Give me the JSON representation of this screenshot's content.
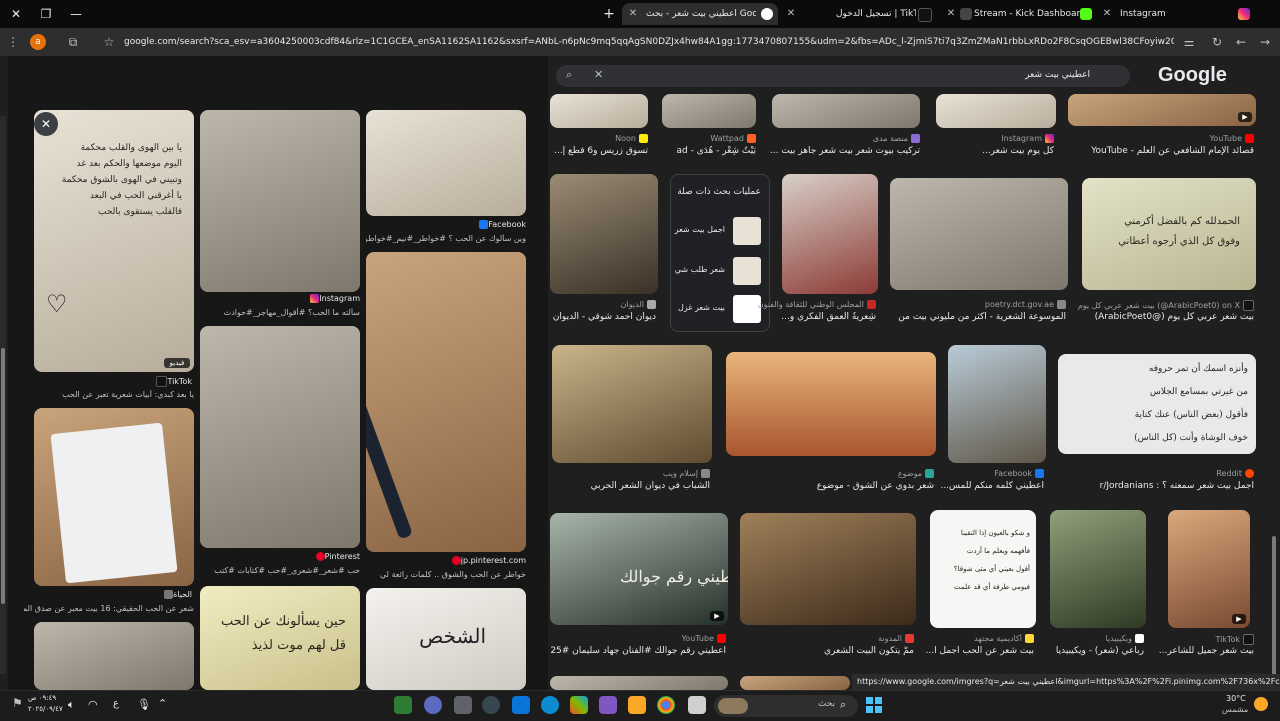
{
  "browser": {
    "tabs": [
      {
        "title": "اعطيني بيت شعر - بحث Google",
        "active": true
      },
      {
        "title": "تسجيل الدخول | TikTok"
      },
      {
        "title": "Stream - Kick Dashboard"
      },
      {
        "title": "Instagram"
      }
    ],
    "url": "google.com/search?sca_esv=a3604250003cdf84&rlz=1C1GCEA_enSA1162SA1162&sxsrf=ANbL-n6pNc9mq5qqAgSN0DZJx4hw84A1gg:1773470807155&udm=2&fbs=ADc_l-ZjmiS7ti7q3ZmZMaN1rbbLxRDo2F8CsqOGEBwl38CFoyiw2Q9xdRS3eeSGvl9LCX...",
    "profile_letter": "a"
  },
  "google": {
    "logo": "Google",
    "query": "اعطيني بيت شعر",
    "account_letter": "a"
  },
  "left_panel": {
    "tiles": [
      {
        "source": "TikTok",
        "title": "يا بعد كبدي: أبيات شعرية تعبر عن الحب",
        "badge": "فيديو"
      },
      {
        "source": "Instagram",
        "title": "سألته ما الحب؟ #أقوال_مهاجر_#حوادث"
      },
      {
        "source": "Facebook",
        "title": "وين سألوك عن الحب ؟ #خواطر_#نيم_#خواطر_حب ق..."
      },
      {
        "source": "الحياة",
        "title": "شعر عن الحب الحقيقي: 16 بيت معبر عن صدق المشاعر"
      },
      {
        "source": "Pinterest",
        "title": "حب #شعر_#شعري_#حب #كتابات #كتب"
      },
      {
        "source": "jp.pinterest.com",
        "title": "خواطر عن الحب والشوق .. كلمات رائعة لي"
      }
    ],
    "img_texts": {
      "card1": "يا بين الهوى والقلب محكمة\nاليوم موضعها والحكم بعد غد\nوتبيني في الهوى بالشوق محكمة\nيا أغرقني الحب في البعد\nفالقلب يستقوى بالحب",
      "card5": "حين يسألونك عن الحب\nقل لهم موت لذيذ",
      "card6": "الشخص"
    }
  },
  "results": {
    "row0": [
      {
        "source": "Noon",
        "title": "تسوق زريس و6 قطع إ..."
      },
      {
        "source": "Wattpad",
        "title": "بَيْتُ شِعْر - هُدَى - ad"
      },
      {
        "source": "منصة مدى",
        "title": "تركيب بيوت شعر بيت شعر جاهز بيت ..."
      },
      {
        "source": "Instagram",
        "title": "كل يوم بيت شعر..."
      },
      {
        "source": "YouTube",
        "title": "قصائد الإمام الشافعي عن العلم - YouTube"
      }
    ],
    "row1": [
      {
        "source": "الديوان",
        "title": "ديوان أحمد شوقي - الديوان"
      },
      {
        "source": "المجلس الوطني للثقافة والفنون",
        "title": "شِعريةُ العمق الفكري و..."
      },
      {
        "source": "poetry.dct.gov.ae",
        "title": "الموسوعة الشعرية - أكثر من مليوني بيت من ا..."
      },
      {
        "source": "بيت شعر عربي كل يوم (@ArabicPoet0) on X",
        "title": "بيت شعر عربي كل يوم (@ArabicPoet0)"
      }
    ],
    "related": {
      "title": "عمليات بحث ذات صلة",
      "items": [
        "اجمل بيت شعر",
        "شعر طلب شي",
        "بيت شعر غزل"
      ]
    },
    "row2": [
      {
        "source": "إسلام ويب",
        "title": "الشباب في ديوان الشعر الحربي"
      },
      {
        "source": "موضوع",
        "title": "شعر بدوي عن الشوق - موضوع"
      },
      {
        "source": "Facebook",
        "title": "اعطيني كلمه منكم للمس..."
      },
      {
        "source": "Reddit",
        "title": "أجمل بيت شعر سمعته ؟ : r/Jordanians"
      }
    ],
    "row3": [
      {
        "source": "YouTube",
        "title": "اعطيني رقم جوالك #الفنان جهاد سليمان #25..."
      },
      {
        "source": "المدونة",
        "title": "ممَّ يتكون البيت الشعري"
      },
      {
        "source": "أكاديمية مجتهد",
        "title": "بيت شعر عن الحب اجمل ا..."
      },
      {
        "source": "ويكيبيديا",
        "title": "رباعي (شعر) - ويكيبيديا"
      },
      {
        "source": "TikTok",
        "title": "بيت شعر جميل للشاعر..."
      }
    ],
    "img_texts": {
      "r0c5": "الحمدلله كم بالفضل أكرمني\nوفوق كل الذي أرجوه أعطاني",
      "r2c4": "وأنزه اسمك أن تمر حروفه\nمن غيرتي بمسامع الجلاس\nفأقول (بعض الناس) عنك كناية\nخوف الوشاة وأنت (كل الناس)",
      "r3c1": "اعطيني رقم جوالك",
      "r3c3": "و شكو بالعيون إذا التقينا\nفأفهمه ويعلم ما أردت\nأقول بعيني أي متى شوقا؟\nفيومي طرفة أي قد علمت"
    }
  },
  "status_url": "https://www.google.com/imgres?q=اعطيني بيت شعر&imgurl=https%3A%2F%2Fi.pinimg.com%2F736x%2Fc8%2F84%...",
  "taskbar": {
    "time": "٠٩:٤٩ ص",
    "date": "٢٠٢٥/٠٩/٤٧",
    "lang": "ع",
    "search_placeholder": "بحث",
    "weather_temp": "30°C",
    "weather_text": "مشمس"
  }
}
